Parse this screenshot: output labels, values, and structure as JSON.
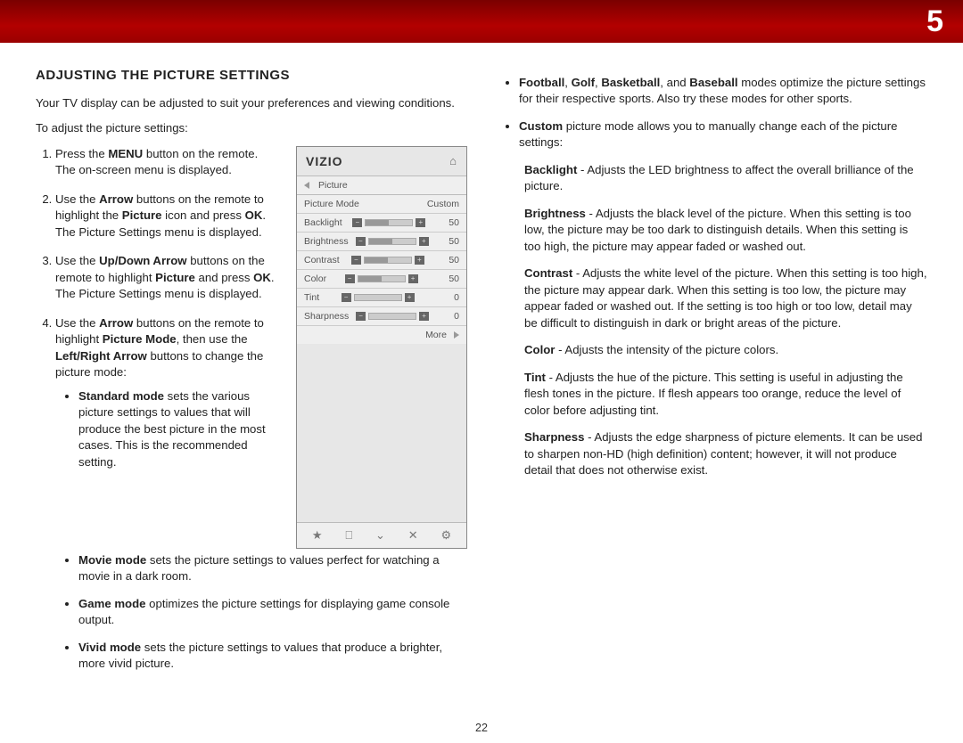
{
  "chapter": "5",
  "page_number": "22",
  "left": {
    "title": "ADJUSTING THE PICTURE SETTINGS",
    "intro": "Your TV display can be adjusted to suit your preferences and viewing conditions.",
    "lead": "To adjust the picture settings:",
    "step1_a": "Press the ",
    "step1_b": "MENU",
    "step1_c": " button on the remote. The on-screen menu is displayed.",
    "step2_a": "Use the ",
    "step2_b": "Arrow",
    "step2_c": " buttons on the remote to highlight the ",
    "step2_d": "Picture",
    "step2_e": " icon and press ",
    "step2_f": "OK",
    "step2_g": ". The Picture Settings menu is displayed.",
    "step3_a": "Use the ",
    "step3_b": "Up/Down Arrow",
    "step3_c": " buttons on the remote to highlight ",
    "step3_d": "Picture",
    "step3_e": " and press ",
    "step3_f": "OK",
    "step3_g": ". The Picture Settings menu is displayed.",
    "step4_a": "Use the ",
    "step4_b": "Arrow",
    "step4_c": " buttons on the remote to highlight ",
    "step4_d": "Picture Mode",
    "step4_e": ", then use the ",
    "step4_f": "Left/Right Arrow",
    "step4_g": " buttons to change the picture mode:",
    "mode_standard_b": "Standard mode",
    "mode_standard_t": " sets the various picture settings to values that will produce the best picture in the most cases. This is the recommended setting.",
    "mode_movie_b": "Movie mode",
    "mode_movie_t": " sets the picture settings to values perfect for watching a movie in a dark room.",
    "mode_game_b": "Game mode",
    "mode_game_t": " optimizes the picture settings for displaying game console output.",
    "mode_vivid_b": "Vivid mode",
    "mode_vivid_t": " sets the picture settings to values that produce a brighter, more vivid picture."
  },
  "right": {
    "sports_b1": "Football",
    "sports_s1": ", ",
    "sports_b2": "Golf",
    "sports_s2": ", ",
    "sports_b3": "Basketball",
    "sports_s3": ", and ",
    "sports_b4": "Baseball",
    "sports_t": " modes optimize the picture settings for their respective sports. Also try these modes for other sports.",
    "custom_b": "Custom",
    "custom_t": " picture mode allows you to manually change each of the picture settings:",
    "backlight_b": "Backlight",
    "backlight_t": " - Adjusts the LED brightness to affect the overall brilliance of the picture.",
    "brightness_b": "Brightness",
    "brightness_t": " - Adjusts the black level of the picture. When this setting is too low, the picture may be too dark to distinguish details. When this setting is too high, the picture may appear faded or washed out.",
    "contrast_b": "Contrast",
    "contrast_t": " - Adjusts the white level of the picture. When this setting is too high, the picture may appear dark. When this setting is too low, the picture may appear faded or washed out. If the setting is too high or too low, detail may be difficult to distinguish in dark or bright areas of the picture.",
    "color_b": "Color",
    "color_t": " - Adjusts the intensity of the picture colors.",
    "tint_b": "Tint",
    "tint_t": " - Adjusts the hue of the picture. This setting is useful in adjusting the flesh tones in the picture. If flesh appears too orange, reduce the level of color before adjusting tint.",
    "sharp_b": "Sharpness",
    "sharp_t": " - Adjusts the edge sharpness of picture elements. It can be used to sharpen non-HD (high definition) content; however, it will not produce detail that does not otherwise exist."
  },
  "vizio": {
    "brand": "VIZIO",
    "bread": "Picture",
    "more": "More",
    "rows": [
      {
        "label": "Picture Mode",
        "val": "Custom",
        "slider": false,
        "fill": 0
      },
      {
        "label": "Backlight",
        "val": "50",
        "slider": true,
        "fill": 50
      },
      {
        "label": "Brightness",
        "val": "50",
        "slider": true,
        "fill": 50
      },
      {
        "label": "Contrast",
        "val": "50",
        "slider": true,
        "fill": 50
      },
      {
        "label": "Color",
        "val": "50",
        "slider": true,
        "fill": 50
      },
      {
        "label": "Tint",
        "val": "0",
        "slider": true,
        "fill": 0
      },
      {
        "label": "Sharpness",
        "val": "0",
        "slider": true,
        "fill": 0
      }
    ]
  }
}
